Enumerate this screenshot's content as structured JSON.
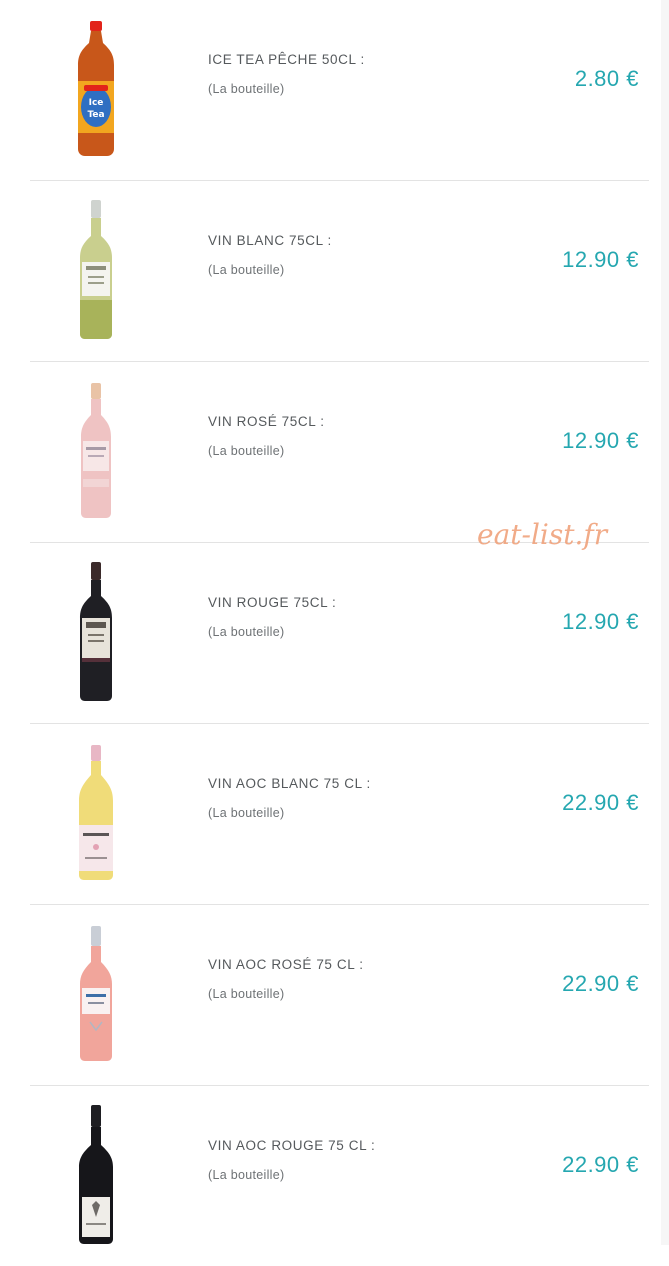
{
  "products": [
    {
      "name": "ICE TEA PÊCHE 50CL :",
      "unit": "(La bouteille)",
      "price": "2.80 €",
      "thumb": "ice-tea-bottle-icon"
    },
    {
      "name": "VIN BLANC 75CL :",
      "unit": "(La bouteille)",
      "price": "12.90 €",
      "thumb": "white-wine-bottle-icon"
    },
    {
      "name": "VIN ROSÉ 75CL :",
      "unit": "(La bouteille)",
      "price": "12.90 €",
      "thumb": "rose-wine-bottle-icon"
    },
    {
      "name": "VIN ROUGE 75CL :",
      "unit": "(La bouteille)",
      "price": "12.90 €",
      "thumb": "red-wine-bottle-icon"
    },
    {
      "name": "VIN AOC BLANC 75 CL :",
      "unit": "(La bouteille)",
      "price": "22.90 €",
      "thumb": "aoc-white-wine-bottle-icon"
    },
    {
      "name": "VIN AOC ROSÉ 75 CL :",
      "unit": "(La bouteille)",
      "price": "22.90 €",
      "thumb": "aoc-rose-wine-bottle-icon"
    },
    {
      "name": "VIN AOC ROUGE 75 CL :",
      "unit": "(La bouteille)",
      "price": "22.90 €",
      "thumb": "aoc-red-wine-bottle-icon"
    }
  ],
  "watermark": "eat-list.fr",
  "colors": {
    "price": "#25a7b0",
    "text": "#55595c",
    "watermark": "#f0a27c"
  }
}
